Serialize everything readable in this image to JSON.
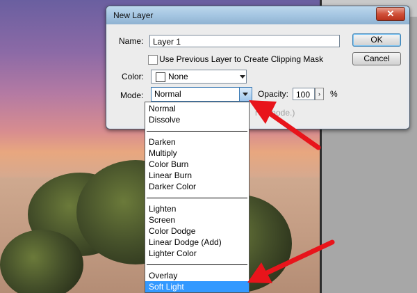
{
  "dialog": {
    "title": "New Layer",
    "close_glyph": "✕",
    "name_label": "Name:",
    "name_value": "Layer 1",
    "clipping_mask_label": "Use Previous Layer to Create Clipping Mask",
    "color_label": "Color:",
    "color_value": "None",
    "mode_label": "Mode:",
    "mode_value": "Normal",
    "opacity_label": "Opacity:",
    "opacity_value": "100",
    "opacity_unit": "%",
    "hint_text": "r      al mode.)",
    "ok_label": "OK",
    "cancel_label": "Cancel"
  },
  "mode_dropdown": {
    "groups": [
      [
        "Normal",
        "Dissolve"
      ],
      [
        "Darken",
        "Multiply",
        "Color Burn",
        "Linear Burn",
        "Darker Color"
      ],
      [
        "Lighten",
        "Screen",
        "Color Dodge",
        "Linear Dodge (Add)",
        "Lighter Color"
      ],
      [
        "Overlay",
        "Soft Light"
      ]
    ],
    "highlighted": "Soft Light"
  },
  "colors": {
    "highlight": "#3399ff",
    "annotation_arrow": "#e8141b"
  },
  "icons": {
    "close": "close-icon",
    "dropdown": "chevron-down-icon",
    "spinner": "chevron-right-icon"
  }
}
